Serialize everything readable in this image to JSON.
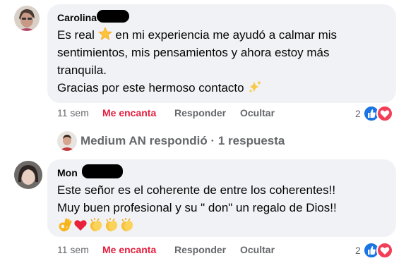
{
  "comments": [
    {
      "author": "Carolina",
      "lines": [
        {
          "before": "Es real ",
          "emoji": "star-emoji",
          "after": " en mi experiencia me ayudó a calmar mis"
        },
        {
          "text": "sentimientos, mis pensamientos y ahora estoy más"
        },
        {
          "text": "tranquila."
        },
        {
          "before": "Gracias por este hermoso contacto ",
          "emoji": "sparkles-emoji",
          "after": ""
        }
      ],
      "actions": {
        "time": "11 sem",
        "reaction": "Me encanta",
        "reply": "Responder",
        "hide": "Ocultar"
      },
      "reaction_count": "2"
    },
    {
      "author": "Mon",
      "lines": [
        {
          "text": "Este señor es el coherente de entre los coherentes!!"
        },
        {
          "text": "Muy buen profesional y su \" don\" un regalo de Dios!!"
        }
      ],
      "emoji_row": [
        "ok-hand-emoji",
        "red-heart-emoji",
        "clapping-hands-emoji",
        "clapping-hands-emoji",
        "clapping-hands-emoji"
      ],
      "actions": {
        "time": "11 sem",
        "reaction": "Me encanta",
        "reply": "Responder",
        "hide": "Ocultar"
      },
      "reaction_count": "2"
    }
  ],
  "reply_summary": {
    "text": "Medium AN respondió · 1 respuesta"
  },
  "colors": {
    "like": "#1b74e4",
    "love": "#e41e3f",
    "bubble": "#f0f2f5",
    "muted": "#65676b"
  }
}
